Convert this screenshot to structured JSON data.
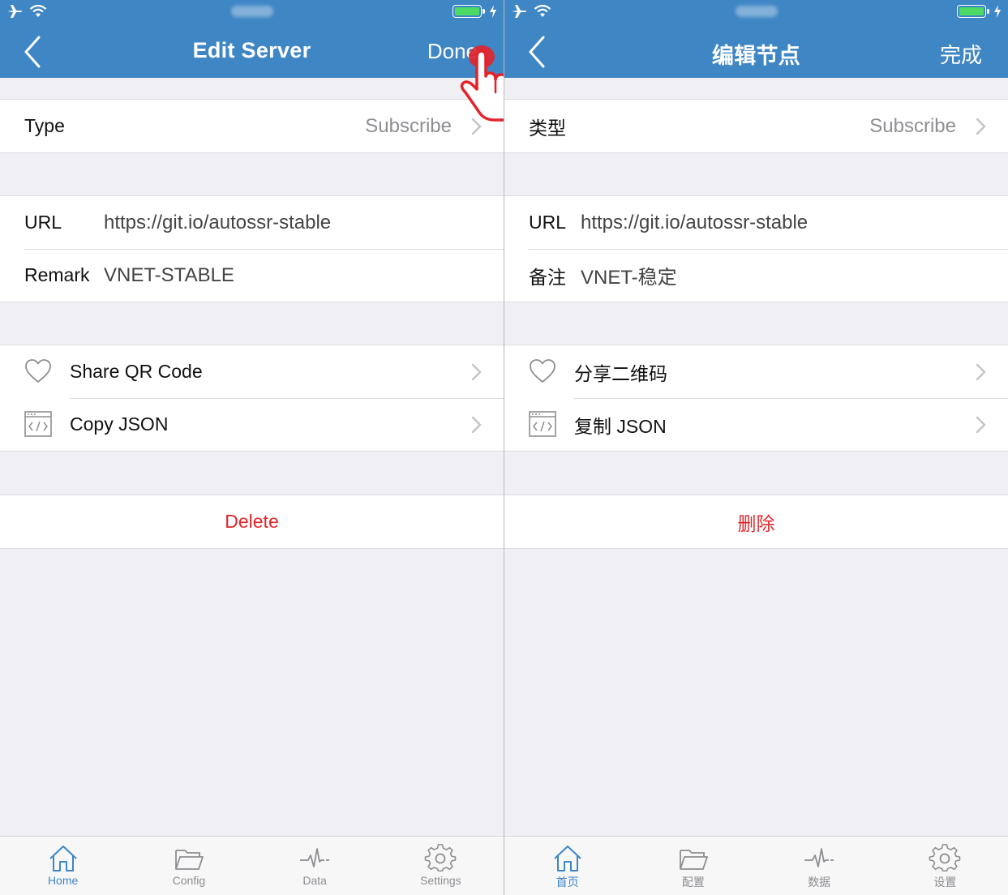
{
  "left": {
    "nav": {
      "title": "Edit Server",
      "done_label": "Done"
    },
    "type": {
      "label": "Type",
      "value": "Subscribe"
    },
    "url": {
      "label": "URL",
      "value": "https://git.io/autossr-stable"
    },
    "remark": {
      "label": "Remark",
      "value": "VNET-STABLE"
    },
    "actions": {
      "share": "Share QR Code",
      "copy": "Copy JSON"
    },
    "delete_label": "Delete",
    "tabs": [
      {
        "label": "Home",
        "icon": "home-icon"
      },
      {
        "label": "Config",
        "icon": "folder-icon"
      },
      {
        "label": "Data",
        "icon": "pulse-icon"
      },
      {
        "label": "Settings",
        "icon": "gear-icon"
      }
    ]
  },
  "right": {
    "nav": {
      "title": "编辑节点",
      "done_label": "完成"
    },
    "type": {
      "label": "类型",
      "value": "Subscribe"
    },
    "url": {
      "label": "URL",
      "value": "https://git.io/autossr-stable"
    },
    "remark": {
      "label": "备注",
      "value": "VNET-稳定"
    },
    "actions": {
      "share": "分享二维码",
      "copy": "复制 JSON"
    },
    "delete_label": "删除",
    "tabs": [
      {
        "label": "首页",
        "icon": "home-icon"
      },
      {
        "label": "配置",
        "icon": "folder-icon"
      },
      {
        "label": "数据",
        "icon": "pulse-icon"
      },
      {
        "label": "设置",
        "icon": "gear-icon"
      }
    ]
  },
  "colors": {
    "nav_bar": "#3f86c5",
    "delete": "#e0262b",
    "active_tab": "#3f86c5",
    "background": "#efeff4",
    "battery": "#4cd964"
  }
}
